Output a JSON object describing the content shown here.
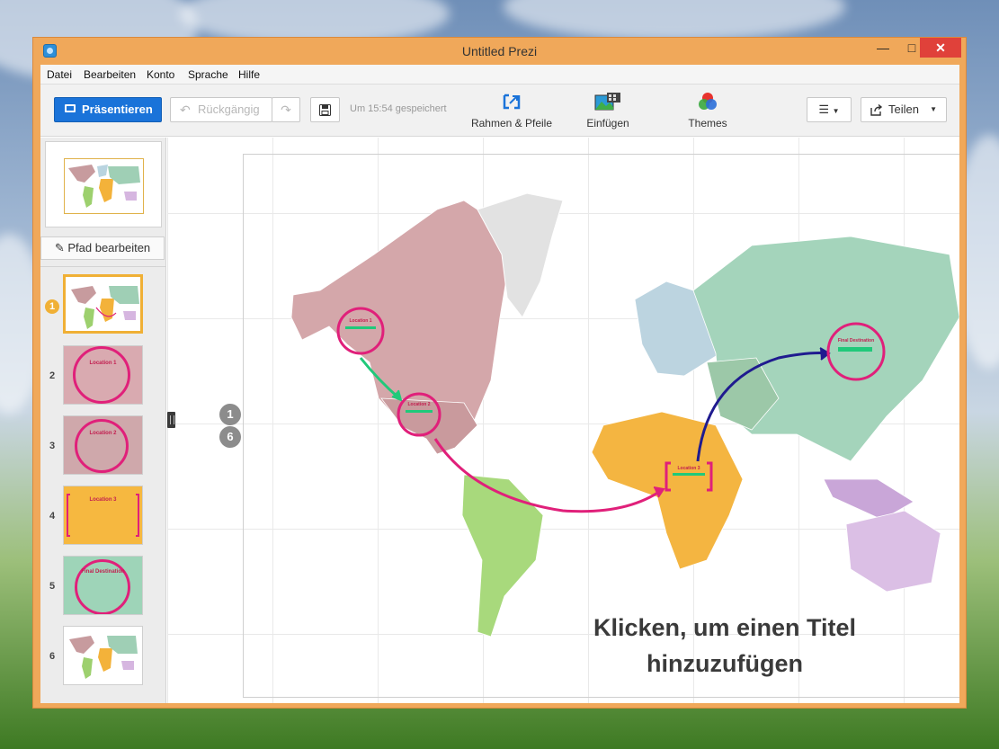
{
  "window": {
    "title": "Untitled Prezi",
    "minimize": "—",
    "maximize": "□",
    "close": "✕"
  },
  "menu": [
    "Datei",
    "Bearbeiten",
    "Konto",
    "Sprache",
    "Hilfe"
  ],
  "toolbar": {
    "present_label": "Präsentieren",
    "undo_label": "Rückgängig",
    "saved_status": "Um 15:54 gespeichert",
    "frames_label": "Rahmen & Pfeile",
    "insert_label": "Einfügen",
    "themes_label": "Themes",
    "share_label": "Teilen"
  },
  "sidebar": {
    "edit_path_label": "Pfad bearbeiten",
    "steps": [
      {
        "num": "1",
        "label": ""
      },
      {
        "num": "2",
        "label": "Location 1"
      },
      {
        "num": "3",
        "label": "Location 2"
      },
      {
        "num": "4",
        "label": "Location 3"
      },
      {
        "num": "5",
        "label": "Final Destination"
      },
      {
        "num": "6",
        "label": ""
      }
    ]
  },
  "canvas": {
    "path_start": "1",
    "path_end": "6",
    "title_line1": "Klicken, um einen Titel",
    "title_line2": "hinzuzufügen",
    "markers": [
      "Location 1",
      "Location 2",
      "Location 3",
      "Final Destination"
    ]
  },
  "colors": {
    "accent": "#1a73d9",
    "ring": "#e0207a",
    "arrow_green": "#20c97a",
    "arrow_navy": "#1f1b8f",
    "window": "#f0a85a"
  }
}
